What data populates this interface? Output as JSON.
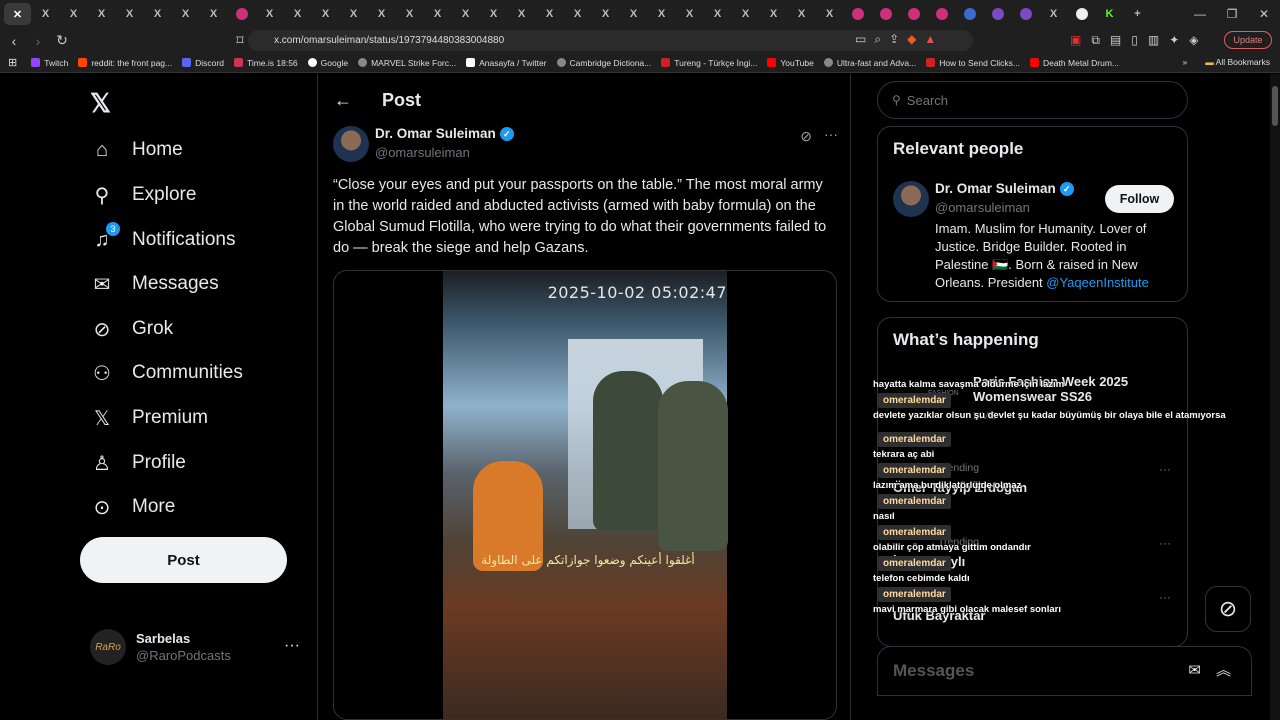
{
  "browser": {
    "url": "x.com/omarsuleiman/status/1973794480383004880",
    "update_label": "Update",
    "tabs": [
      {
        "icon": "close-icon",
        "active": true,
        "glyph": "✕"
      },
      {
        "icon": "x-logo-icon",
        "glyph": "X"
      },
      {
        "icon": "x-logo-icon",
        "glyph": "X"
      },
      {
        "icon": "x-logo-icon",
        "glyph": "X"
      },
      {
        "icon": "x-logo-icon",
        "glyph": "X"
      },
      {
        "icon": "close-icon",
        "glyph": "✕"
      },
      {
        "icon": "close-icon",
        "glyph": "✕"
      },
      {
        "icon": "close-icon",
        "glyph": "✕"
      },
      {
        "icon": "pink-circle-icon",
        "glyph": "●"
      },
      {
        "icon": "x-logo-icon",
        "glyph": "X"
      }
    ],
    "bookmarks": [
      {
        "label": "Twitch",
        "color": "#9146ff"
      },
      {
        "label": "reddit: the front pag...",
        "color": "#ff4500"
      },
      {
        "label": "Discord",
        "color": "#5865f2"
      },
      {
        "label": "Time.is 18:56",
        "color": "#cc3355"
      },
      {
        "label": "Google",
        "color": "#ffffff"
      },
      {
        "label": "MARVEL Strike Forc...",
        "color": "#888888"
      },
      {
        "label": "Anasayfa / Twitter",
        "color": "#ffffff"
      },
      {
        "label": "Cambridge Dictiona...",
        "color": "#888888"
      },
      {
        "label": "Tureng - Türkçe İngi...",
        "color": "#cc2222"
      },
      {
        "label": "YouTube",
        "color": "#ff0000"
      },
      {
        "label": "Ultra-fast and Adva...",
        "color": "#888888"
      },
      {
        "label": "How to Send Clicks...",
        "color": "#cc2222"
      },
      {
        "label": "Death Metal Drum...",
        "color": "#ff0000"
      }
    ],
    "all_bookmarks": "All Bookmarks"
  },
  "nav": {
    "items": [
      {
        "label": "Home",
        "icon": "home-icon",
        "glyph": "⌂"
      },
      {
        "label": "Explore",
        "icon": "search-icon",
        "glyph": "⌕"
      },
      {
        "label": "Notifications",
        "icon": "bell-icon",
        "glyph": "🔔"
      },
      {
        "label": "Messages",
        "icon": "mail-icon",
        "glyph": "✉"
      },
      {
        "label": "Grok",
        "icon": "grok-icon",
        "glyph": "⊘"
      },
      {
        "label": "Communities",
        "icon": "people-icon",
        "glyph": "👥"
      },
      {
        "label": "Premium",
        "icon": "x-logo-icon",
        "glyph": "X"
      },
      {
        "label": "Profile",
        "icon": "person-icon",
        "glyph": "👤"
      },
      {
        "label": "More",
        "icon": "more-circle-icon",
        "glyph": "⋯"
      }
    ],
    "notifications_badge": "3",
    "post_button": "Post",
    "account": {
      "name": "Sarbelas",
      "handle": "@RaroPodcasts",
      "avatar_text": "RaRo"
    }
  },
  "main": {
    "header_title": "Post",
    "author_name": "Dr. Omar Suleiman",
    "author_handle": "@omarsuleiman",
    "tweet_text": "“Close your eyes and put your passports on the table.” The most moral army in the world raided and abducted activists (armed with baby formula) on the Global Sumud Flotilla, who were trying to do what their governments failed to do — break the siege and help Gazans.",
    "video_timestamp": "2025-10-02 05:02:47",
    "video_subtitle": "أغلقوا أعينكم وضعوا جوازاتكم على الطاولة"
  },
  "sidebar": {
    "search_placeholder": "Search",
    "relevant_title": "Relevant people",
    "rel_name": "Dr. Omar Suleiman",
    "rel_handle": "@omarsuleiman",
    "follow_label": "Follow",
    "bio_text": "Imam. Muslim for Humanity. Lover of Justice. Bridge Builder. Rooted in Palestine 🇵🇸. Born & raised in New Orleans. President ",
    "bio_link": "@YaqeenInstitute",
    "happening_title": "What’s happening",
    "trends": [
      {
        "meta": "FASHION",
        "title": "Paris Fashion Week 2025 Womenswear SS26",
        "extra": "LIVE"
      },
      {
        "meta": "Trending",
        "title": "Ömer Tayyip Erdoğan"
      },
      {
        "meta": "Trending",
        "title": "İlber Ortaylı"
      },
      {
        "meta": "",
        "title": "Ufuk Bayraktar"
      }
    ],
    "messages_label": "Messages"
  },
  "chat_overlay": [
    {
      "user": "",
      "msg": "hayatta kalma savaşma oldurme için lazım"
    },
    {
      "user": "omeralemdar",
      "msg": "devlete yazıklar olsun şu devlet şu kadar büyümüş bir olaya bile el atamıyorsa"
    },
    {
      "user": "omeralemdar",
      "msg": "tekrara aç abi"
    },
    {
      "user": "omeralemdar",
      "msg": "lazım ama bu diklatörlüjde olmaz"
    },
    {
      "user": "omeralemdar",
      "msg": "nasıl"
    },
    {
      "user": "omeralemdar",
      "msg": "olabilir çöp atmaya gittim ondandır"
    },
    {
      "user": "omeralemdar",
      "msg": "telefon cebimde kaldı"
    },
    {
      "user": "omeralemdar",
      "msg": "mavi marmara gibi olacak malesef sonları"
    }
  ]
}
